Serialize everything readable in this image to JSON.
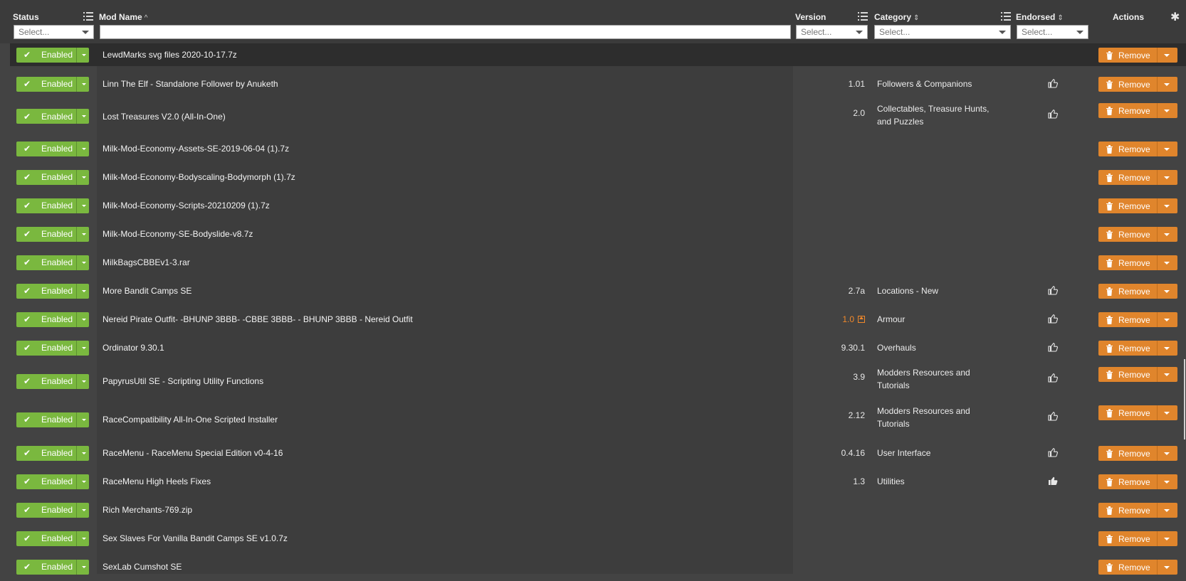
{
  "header": {
    "status": "Status",
    "mod_name": "Mod Name",
    "mod_name_sort": "^",
    "version": "Version",
    "category": "Category",
    "category_sort": "⇕",
    "endorsed": "Endorsed",
    "endorsed_sort": "⇕",
    "actions": "Actions"
  },
  "filters": {
    "status": "Select...",
    "mod_name": "",
    "version": "Select...",
    "category": "Select...",
    "endorsed": "Select..."
  },
  "colors": {
    "enabled": "#7ab83f",
    "remove": "#e0852c",
    "update": "#f0882a"
  },
  "labels": {
    "enabled": "Enabled",
    "remove": "Remove"
  },
  "rows": [
    {
      "name": "LewdMarks svg files 2020-10-17.7z",
      "version": "",
      "category": "",
      "endorsed": false,
      "highlight": true
    },
    {
      "name": "Linn The Elf - Standalone Follower by Anuketh",
      "version": "1.01",
      "category": "Followers & Companions",
      "endorsed": "outline"
    },
    {
      "name": "Lost Treasures V2.0 (All-In-One)",
      "version": "2.0",
      "category": "Collectables, Treasure Hunts, and Puzzles",
      "endorsed": "outline"
    },
    {
      "name": "Milk-Mod-Economy-Assets-SE-2019-06-04 (1).7z",
      "version": "",
      "category": "",
      "endorsed": false
    },
    {
      "name": "Milk-Mod-Economy-Bodyscaling-Bodymorph (1).7z",
      "version": "",
      "category": "",
      "endorsed": false
    },
    {
      "name": "Milk-Mod-Economy-Scripts-20210209 (1).7z",
      "version": "",
      "category": "",
      "endorsed": false
    },
    {
      "name": "Milk-Mod-Economy-SE-Bodyslide-v8.7z",
      "version": "",
      "category": "",
      "endorsed": false
    },
    {
      "name": "MilkBagsCBBEv1-3.rar",
      "version": "",
      "category": "",
      "endorsed": false
    },
    {
      "name": "More Bandit Camps SE",
      "version": "2.7a",
      "category": "Locations - New",
      "endorsed": "outline"
    },
    {
      "name": "Nereid Pirate Outfit- -BHUNP 3BBB- -CBBE 3BBB- - BHUNP 3BBB - Nereid Outfit",
      "version": "1.0",
      "version_update": true,
      "category": "Armour",
      "endorsed": "outline"
    },
    {
      "name": "Ordinator 9.30.1",
      "version": "9.30.1",
      "category": "Overhauls",
      "endorsed": "outline"
    },
    {
      "name": "PapyrusUtil SE - Scripting Utility Functions",
      "version": "3.9",
      "category": "Modders Resources and Tutorials",
      "endorsed": "outline"
    },
    {
      "name": "RaceCompatibility All-In-One Scripted Installer",
      "version": "2.12",
      "category": "Modders Resources and Tutorials",
      "endorsed": "outline"
    },
    {
      "name": "RaceMenu - RaceMenu Special Edition v0-4-16",
      "version": "0.4.16",
      "category": "User Interface",
      "endorsed": "outline"
    },
    {
      "name": "RaceMenu High Heels Fixes",
      "version": "1.3",
      "category": "Utilities",
      "endorsed": "filled"
    },
    {
      "name": "Rich Merchants-769.zip",
      "version": "",
      "category": "",
      "endorsed": false
    },
    {
      "name": "Sex Slaves For Vanilla Bandit Camps SE v1.0.7z",
      "version": "",
      "category": "",
      "endorsed": false
    },
    {
      "name": "SexLab Cumshot SE",
      "version": "",
      "category": "",
      "endorsed": false
    }
  ]
}
